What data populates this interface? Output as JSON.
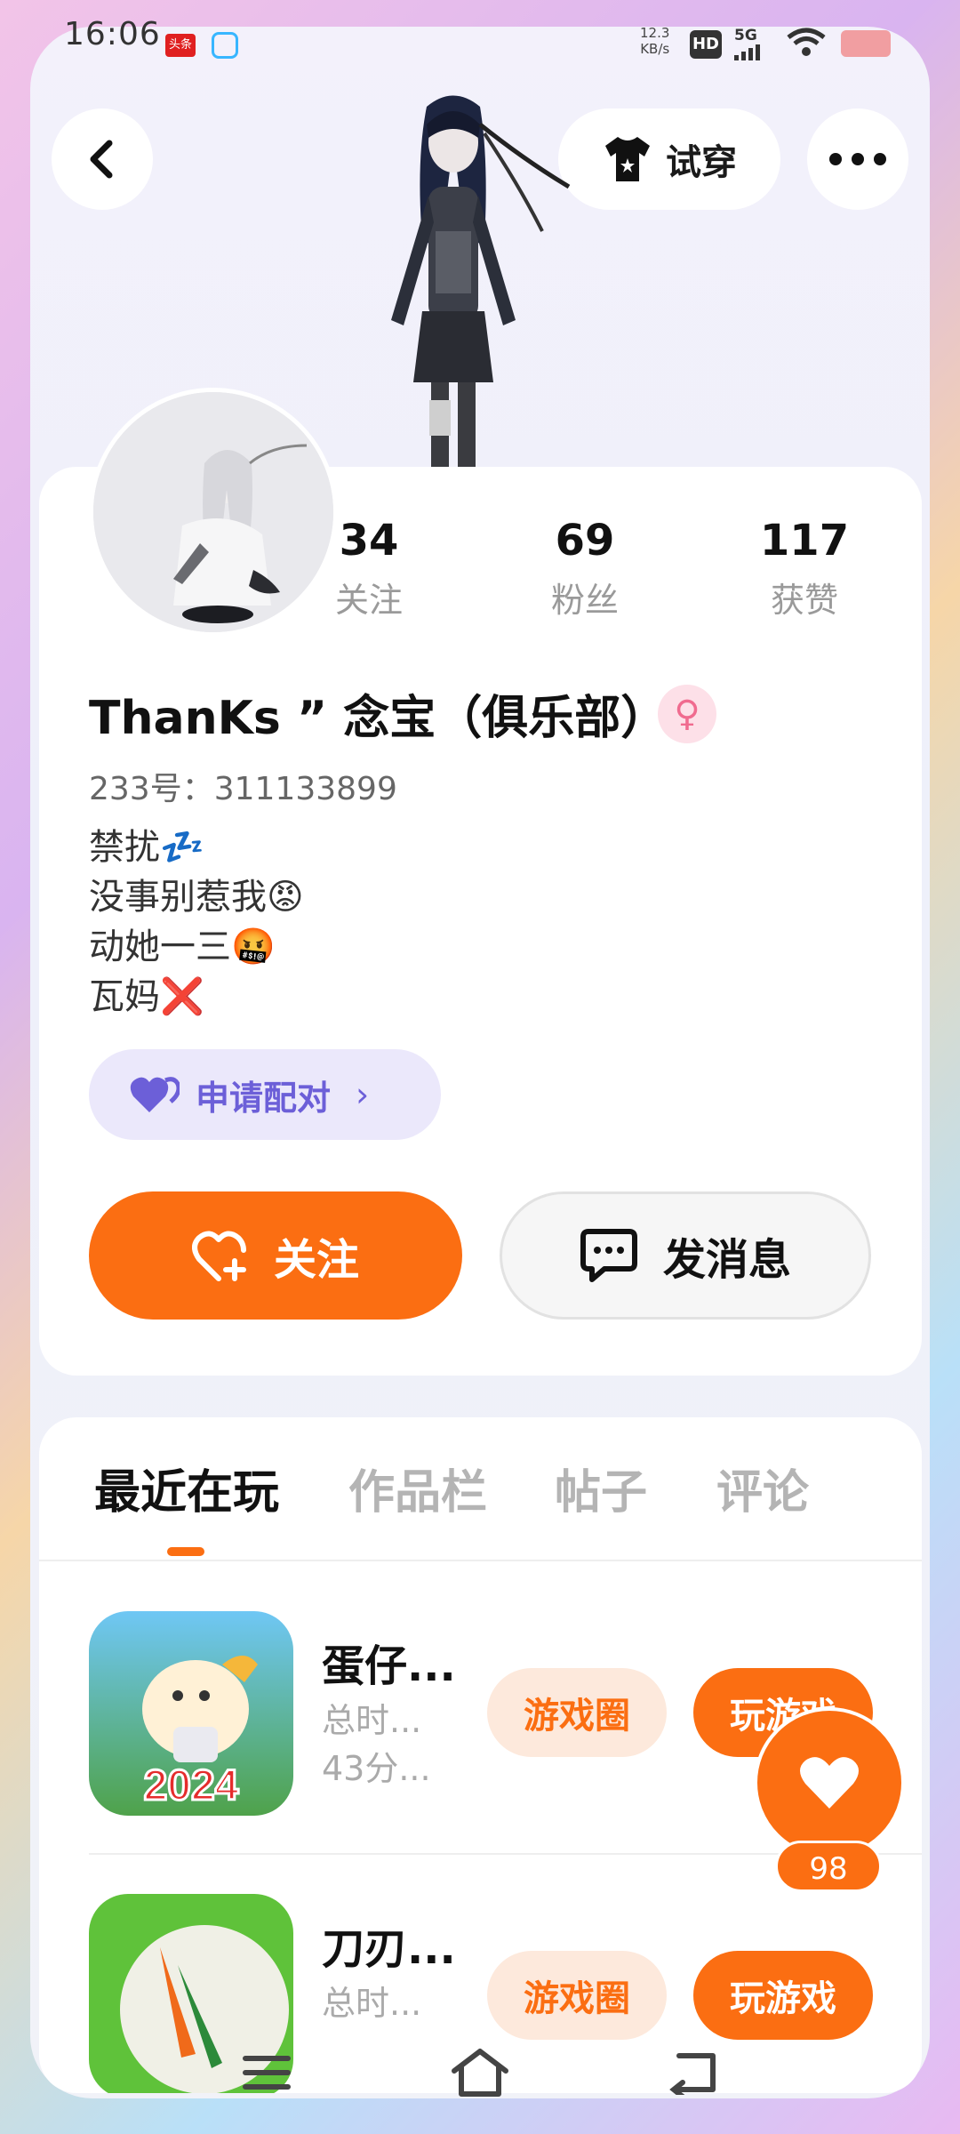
{
  "status_bar": {
    "time": "16:06",
    "app1_label": "头条",
    "speed_value": "12.3",
    "speed_unit": "KB/s",
    "hd": "HD",
    "network": "5G"
  },
  "header": {
    "try_on_label": "试穿"
  },
  "stats": [
    {
      "value": "34",
      "label": "关注"
    },
    {
      "value": "69",
      "label": "粉丝"
    },
    {
      "value": "117",
      "label": "获赞"
    }
  ],
  "profile": {
    "nickname": "ThanKs ” 念宝（俱乐部）",
    "gender_symbol": "♀",
    "uid": "233号：311133899",
    "bio": [
      "禁扰💤",
      "没事别惹我😡",
      "动她一三🤬",
      "瓦妈❌"
    ]
  },
  "pair_button": {
    "label": "申请配对",
    "arrow": "›"
  },
  "actions": {
    "follow_label": "关注",
    "message_label": "发消息"
  },
  "tabs": [
    {
      "label": "最近在玩",
      "active": true
    },
    {
      "label": "作品栏",
      "active": false
    },
    {
      "label": "帖子",
      "active": false
    },
    {
      "label": "评论",
      "active": false
    }
  ],
  "games": [
    {
      "name": "蛋仔...",
      "meta1": "总时...",
      "meta2": "43分...",
      "icon_text": "2024",
      "circle_label": "游戏圈",
      "play_label": "玩游戏"
    },
    {
      "name": "刀刃...",
      "meta1": "总时...",
      "meta2": "",
      "icon_text": "",
      "circle_label": "游戏圈",
      "play_label": "玩游戏"
    }
  ],
  "like_fab": {
    "count": "98"
  },
  "colors": {
    "accent": "#fb6e12",
    "pair": "#6c5fd8",
    "pair_bg": "#ebe8fb"
  }
}
